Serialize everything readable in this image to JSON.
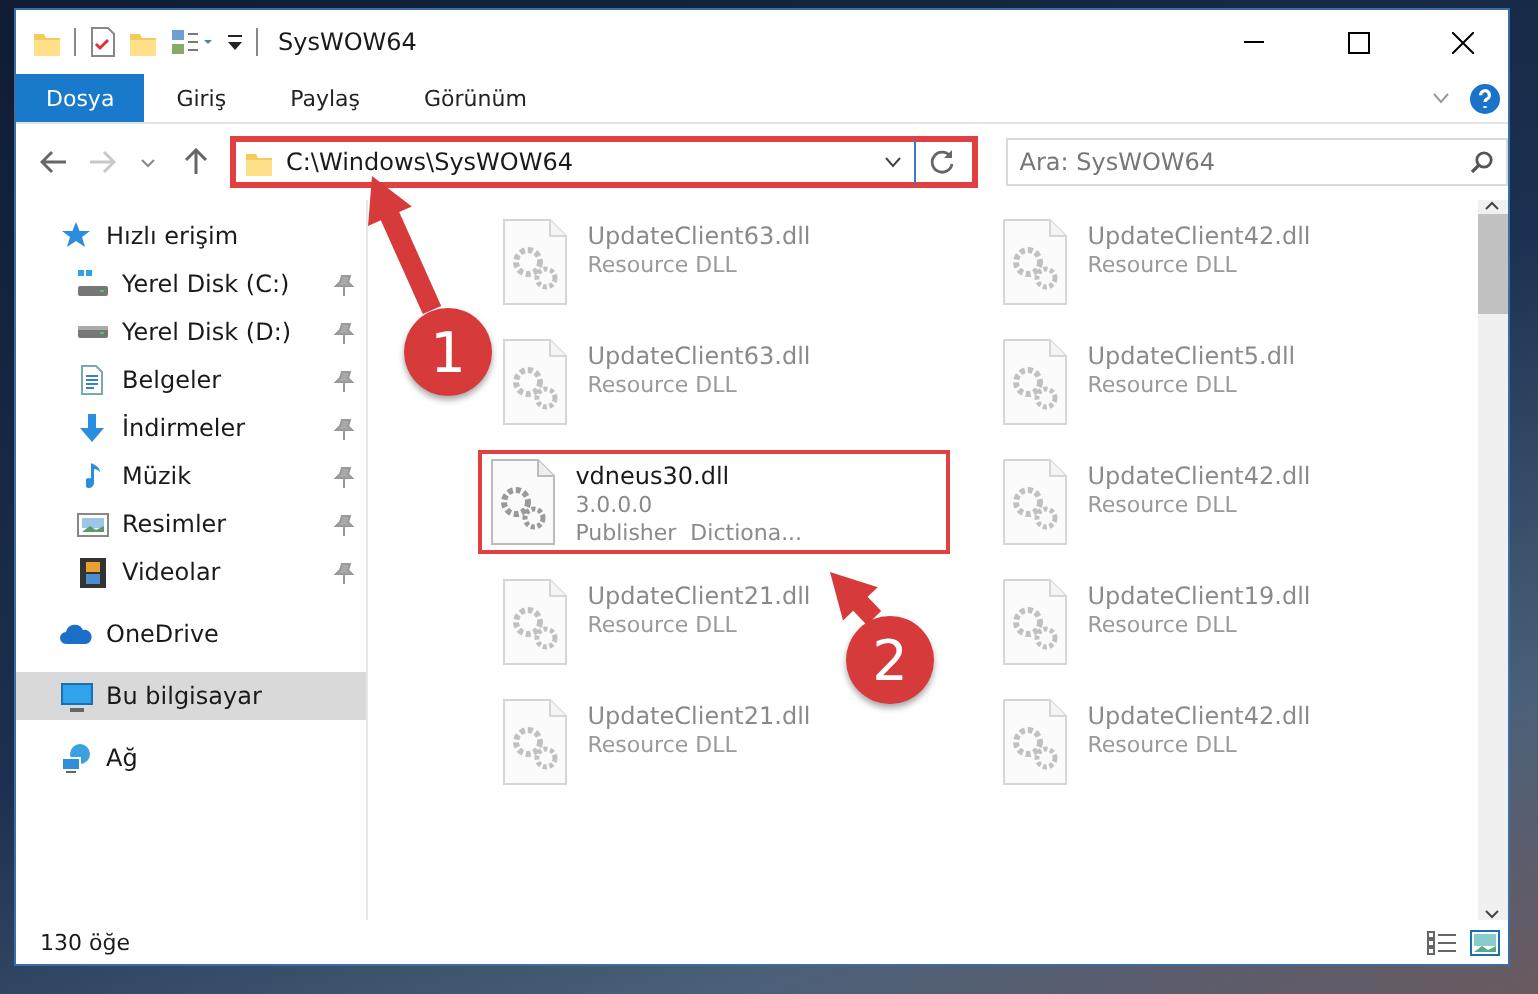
{
  "window": {
    "title": "SysWOW64"
  },
  "ribbon_tabs": [
    {
      "label": "Dosya",
      "selected": true
    },
    {
      "label": "Giriş",
      "selected": false
    },
    {
      "label": "Paylaş",
      "selected": false
    },
    {
      "label": "Görünüm",
      "selected": false
    }
  ],
  "address_bar": {
    "path": "C:\\Windows\\SysWOW64",
    "highlighted": true
  },
  "search": {
    "placeholder": "Ara: SysWOW64"
  },
  "navigation": [
    {
      "label": "Hızlı erişim",
      "kind": "star",
      "selected": false,
      "children": [
        {
          "label": "Yerel Disk (C:)",
          "kind": "drive-c",
          "selected": false,
          "pinned": true
        },
        {
          "label": "Yerel Disk (D:)",
          "kind": "drive",
          "selected": false,
          "pinned": true
        },
        {
          "label": "Belgeler",
          "kind": "document",
          "selected": false,
          "pinned": true
        },
        {
          "label": "İndirmeler",
          "kind": "download",
          "selected": false,
          "pinned": true
        },
        {
          "label": "Müzik",
          "kind": "music",
          "selected": false,
          "pinned": true
        },
        {
          "label": "Resimler",
          "kind": "pictures",
          "selected": false,
          "pinned": true
        },
        {
          "label": "Videolar",
          "kind": "videos",
          "selected": false,
          "pinned": true
        }
      ]
    },
    {
      "label": "OneDrive",
      "kind": "cloud",
      "selected": false
    },
    {
      "label": "Bu bilgisayar",
      "kind": "computer",
      "selected": true
    },
    {
      "label": "Ağ",
      "kind": "network",
      "selected": false
    }
  ],
  "files": [
    {
      "name": "UpdateClient63.dll",
      "details": [
        "Resource DLL"
      ],
      "blurred": true,
      "highlighted": false
    },
    {
      "name": "UpdateClient42.dll",
      "details": [
        "Resource DLL"
      ],
      "blurred": true,
      "highlighted": false
    },
    {
      "name": "UpdateClient63.dll",
      "details": [
        "Resource DLL"
      ],
      "blurred": true,
      "highlighted": false
    },
    {
      "name": "UpdateClient5.dll",
      "details": [
        "Resource DLL"
      ],
      "blurred": true,
      "highlighted": false
    },
    {
      "name": "vdneus30.dll",
      "details": [
        "3.0.0.0",
        "Publisher  Dictiona..."
      ],
      "blurred": false,
      "highlighted": true
    },
    {
      "name": "UpdateClient42.dll",
      "details": [
        "Resource DLL"
      ],
      "blurred": true,
      "highlighted": false
    },
    {
      "name": "UpdateClient21.dll",
      "details": [
        "Resource DLL"
      ],
      "blurred": true,
      "highlighted": false
    },
    {
      "name": "UpdateClient19.dll",
      "details": [
        "Resource DLL"
      ],
      "blurred": true,
      "highlighted": false
    },
    {
      "name": "UpdateClient21.dll",
      "details": [
        "Resource DLL"
      ],
      "blurred": true,
      "highlighted": false
    },
    {
      "name": "UpdateClient42.dll",
      "details": [
        "Resource DLL"
      ],
      "blurred": true,
      "highlighted": false
    }
  ],
  "status_bar": {
    "item_count": "130 öğe"
  },
  "annotations": [
    {
      "number": "1"
    },
    {
      "number": "2"
    }
  ]
}
